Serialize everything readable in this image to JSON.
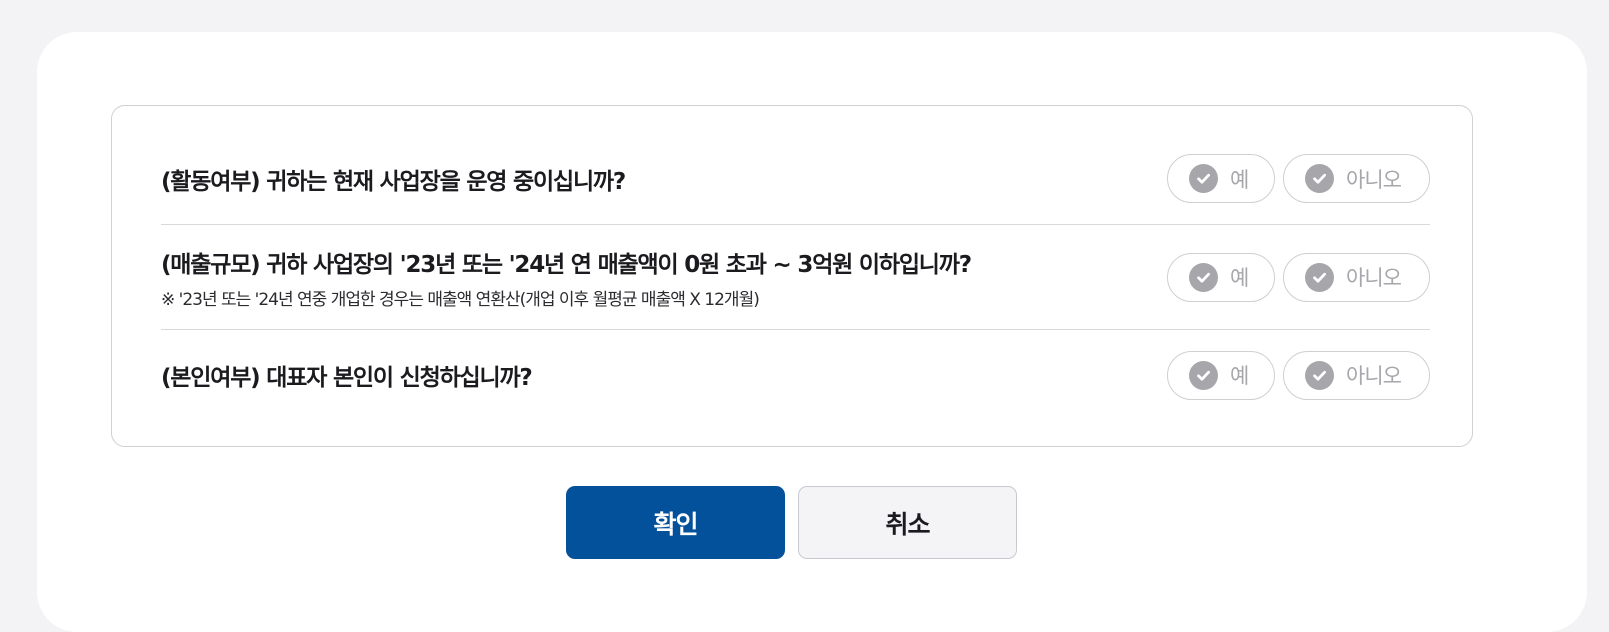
{
  "questions": [
    {
      "title": "(활동여부) 귀하는 현재 사업장을 운영 중이십니까?",
      "note": "",
      "yes_label": "예",
      "no_label": "아니오"
    },
    {
      "title": "(매출규모) 귀하 사업장의 '23년 또는 '24년 연 매출액이 0원 초과 ~ 3억원 이하입니까?",
      "note": "※ '23년 또는 '24년 연중 개업한 경우는 매출액 연환산(개업 이후 월평균 매출액 X 12개월)",
      "yes_label": "예",
      "no_label": "아니오"
    },
    {
      "title": "(본인여부) 대표자 본인이 신청하십니까?",
      "note": "",
      "yes_label": "예",
      "no_label": "아니오"
    }
  ],
  "buttons": {
    "confirm_label": "확인",
    "cancel_label": "취소"
  },
  "icons": {
    "option_check": "check-circle-icon"
  },
  "colors": {
    "primary": "#03519b",
    "option_inactive": "#a6a6ab",
    "border": "#cfcfd4"
  }
}
